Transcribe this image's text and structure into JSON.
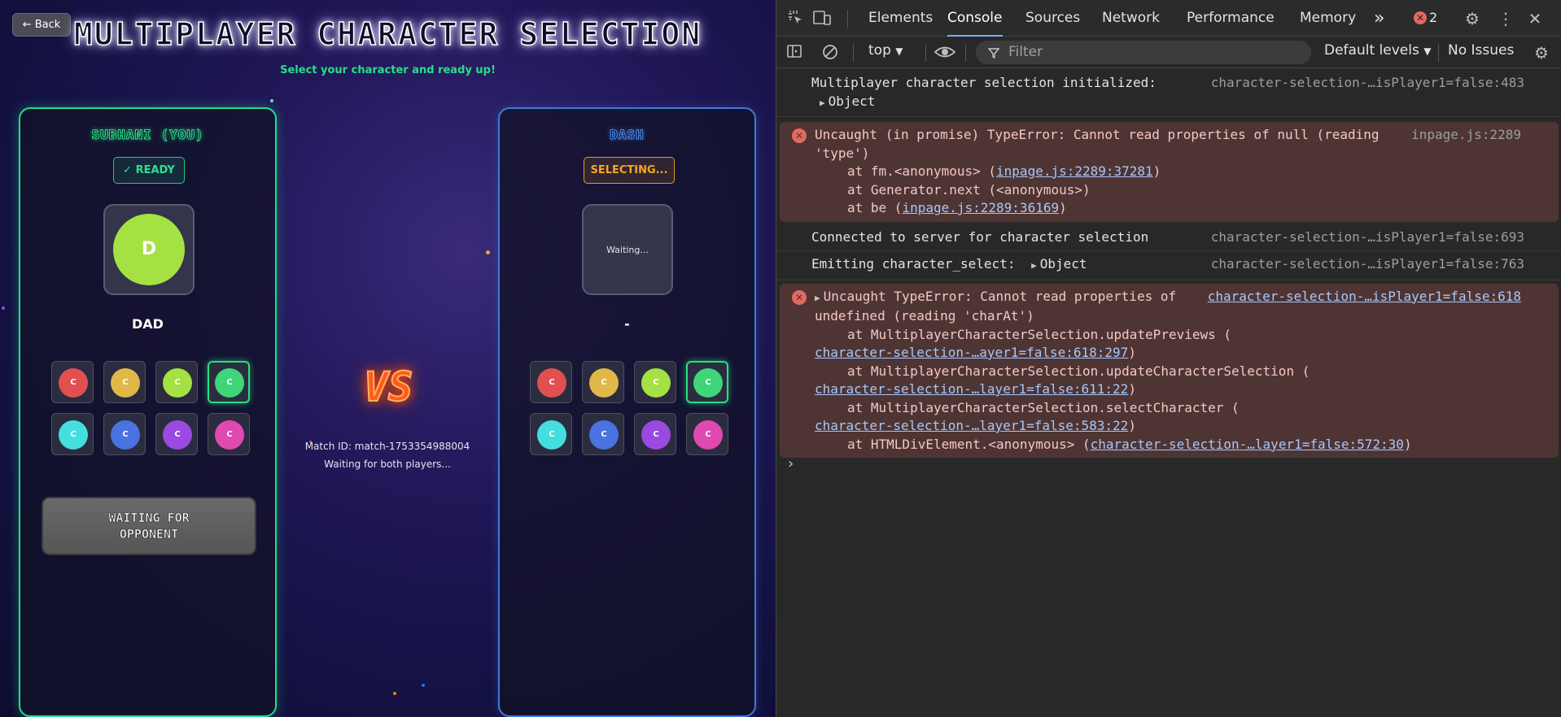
{
  "game": {
    "back_label": "← Back",
    "title": "MULTIPLAYER CHARACTER SELECTION",
    "subtitle": "Select your character and ready up!",
    "vs": "VS",
    "match_id": "Match ID: match-1753354988004",
    "waiting_both": "Waiting for both players...",
    "colors": {
      "ready_green": "#20e08a",
      "opponent_blue": "#3d7cd6",
      "selecting_orange": "#f5a623",
      "vs_orange": "#ff5a1f"
    },
    "player1": {
      "name": "SUBHANI (YOU)",
      "status": "✓ READY",
      "preview_letter": "D",
      "preview_color": "#a6e143",
      "character_name": "DAD",
      "button_label": "WAITING FOR OPPONENT"
    },
    "player2": {
      "name": "DASH",
      "status": "SELECTING...",
      "preview_text": "Waiting...",
      "character_name": "-"
    },
    "characters": [
      {
        "letter": "C",
        "color": "#e05050"
      },
      {
        "letter": "C",
        "color": "#e0b84a"
      },
      {
        "letter": "C",
        "color": "#a6e143"
      },
      {
        "letter": "C",
        "color": "#3fd67a"
      },
      {
        "letter": "C",
        "color": "#45dede"
      },
      {
        "letter": "C",
        "color": "#4a72e0"
      },
      {
        "letter": "C",
        "color": "#9a4ae0"
      },
      {
        "letter": "C",
        "color": "#e04ab0"
      }
    ],
    "selected_index": 3
  },
  "devtools": {
    "tabs": [
      "Elements",
      "Console",
      "Sources",
      "Network",
      "Performance",
      "Memory"
    ],
    "active_tab": "Console",
    "more_tabs": "»",
    "error_count": "2",
    "context": "top",
    "filter_placeholder": "Filter",
    "levels": "Default levels",
    "issues": "No Issues",
    "icons": [
      "inspect-icon",
      "device-toolbar-icon",
      "more-tabs-icon",
      "error-icon",
      "settings-icon",
      "kebab-menu-icon",
      "close-icon",
      "sidebar-icon",
      "clear-icon",
      "eye-icon",
      "filter-icon",
      "console-settings-icon"
    ],
    "messages": [
      {
        "type": "log",
        "text": "Multiplayer character selection initialized:",
        "source": "character-selection-…isPlayer1=false:483",
        "line2": "Object"
      },
      {
        "type": "error",
        "line1": "Uncaught (in promise) TypeError: Cannot read properties of null (reading",
        "line1b": "'type')",
        "source": "inpage.js:2289",
        "stack": [
          {
            "pre": "at fm.<anonymous> (",
            "link": "inpage.js:2289:37281",
            "post": ")"
          },
          {
            "pre": "at Generator.next (<anonymous>)",
            "link": "",
            "post": ""
          },
          {
            "pre": "at be (",
            "link": "inpage.js:2289:36169",
            "post": ")"
          }
        ]
      },
      {
        "type": "log",
        "text": "Connected to server for character selection",
        "source": "character-selection-…isPlayer1=false:693"
      },
      {
        "type": "log",
        "text": "Emitting character_select:",
        "obj": "Object",
        "source": "character-selection-…isPlayer1=false:763"
      },
      {
        "type": "error",
        "line1": "Uncaught TypeError: Cannot read properties of",
        "line1b": "undefined (reading 'charAt')",
        "source": "character-selection-…isPlayer1=false:618",
        "stack": [
          {
            "pre": "at MultiplayerCharacterSelection.updatePreviews (",
            "link": "character-selection-…ayer1=false:618:297",
            "post": ")"
          },
          {
            "pre": "at MultiplayerCharacterSelection.updateCharacterSelection (",
            "link": "character-selection-…layer1=false:611:22",
            "post": ")"
          },
          {
            "pre": "at MultiplayerCharacterSelection.selectCharacter (",
            "link": "character-selection-…layer1=false:583:22",
            "post": ")"
          },
          {
            "pre": "at HTMLDivElement.<anonymous> (",
            "link": "character-selection-…layer1=false:572:30",
            "post": ")"
          }
        ]
      }
    ],
    "prompt": "›"
  }
}
